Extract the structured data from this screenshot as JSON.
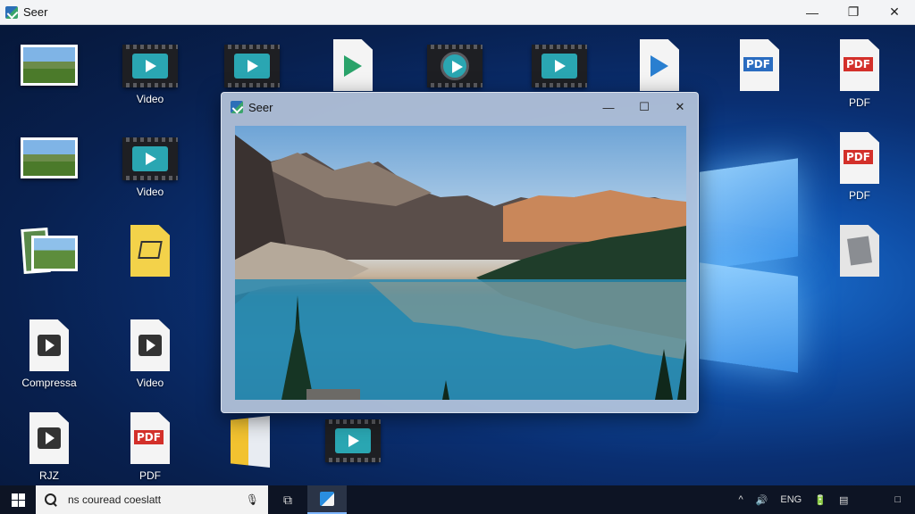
{
  "app": {
    "title": "Seer",
    "controls": {
      "minimize": "—",
      "maximize": "❐",
      "close": "✕"
    }
  },
  "viewer": {
    "title": "Seer",
    "controls": {
      "minimize": "—",
      "maximize": "☐",
      "close": "✕"
    },
    "image_description_icon": "mountain-lake-photo"
  },
  "desktop_icons": [
    {
      "type": "photo",
      "label": ""
    },
    {
      "type": "video",
      "label": "Video"
    },
    {
      "type": "video",
      "label": ""
    },
    {
      "type": "doc-play",
      "label": ""
    },
    {
      "type": "video-round",
      "label": ""
    },
    {
      "type": "video",
      "label": ""
    },
    {
      "type": "doc-play-blue",
      "label": ""
    },
    {
      "type": "pdf-blue",
      "label": "",
      "tag": "PDF"
    },
    {
      "type": "pdf",
      "label": "PDF",
      "tag": "PDF"
    },
    {
      "type": "photo",
      "label": ""
    },
    {
      "type": "video",
      "label": "Video"
    },
    {
      "type": "pdf",
      "label": "PDF",
      "tag": "PDF"
    },
    {
      "type": "photo-stack",
      "label": ""
    },
    {
      "type": "doc-yellow",
      "label": ""
    },
    {
      "type": "doc-gray",
      "label": ""
    },
    {
      "type": "doc-dark",
      "label": "Compressa"
    },
    {
      "type": "doc-dark",
      "label": "Video"
    },
    {
      "type": "doc-dark-badge",
      "label": "RJZ"
    },
    {
      "type": "pdf",
      "label": "PDF",
      "tag": "PDF"
    },
    {
      "type": "folder",
      "label": ""
    },
    {
      "type": "video",
      "label": ""
    }
  ],
  "taskbar": {
    "search_text": "ns couread coeslatt",
    "mic_icon": "microphone-icon",
    "tray": [
      "^",
      "🔊",
      "ENG",
      "🔋",
      "▤"
    ],
    "notification_icon": "□"
  }
}
